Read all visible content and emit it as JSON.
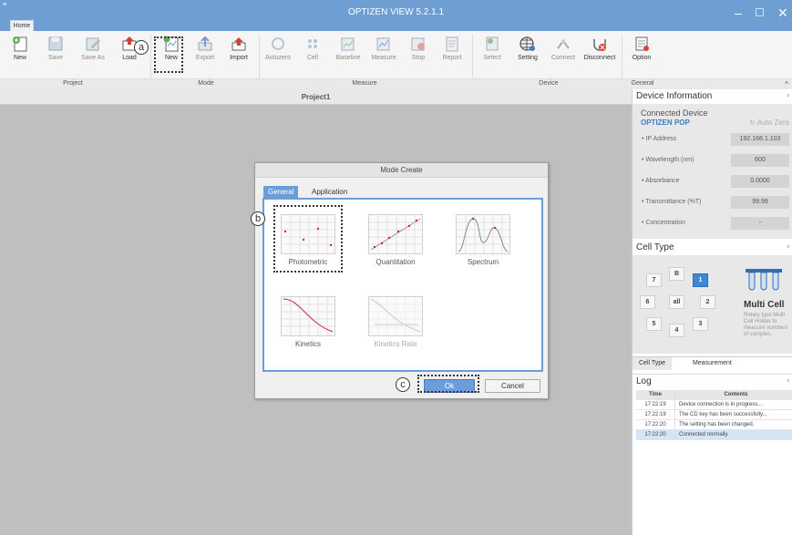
{
  "window": {
    "title": "OPTIZEN VIEW 5.2.1.1",
    "tab_home": "Home",
    "quick_access": "≡"
  },
  "ribbon": {
    "project": {
      "label": "Project",
      "buttons": [
        "New",
        "Save",
        "Save As",
        "Load"
      ]
    },
    "mode": {
      "label": "Mode",
      "buttons": [
        "New",
        "Export",
        "Import"
      ]
    },
    "measure": {
      "label": "Measure",
      "buttons": [
        "Autozero",
        "Cell",
        "Baseline",
        "Measure",
        "Stop",
        "Report"
      ]
    },
    "device": {
      "label": "Device",
      "buttons": [
        "Select",
        "Setting",
        "Connect",
        "Disconnect"
      ]
    },
    "general": {
      "label": "General",
      "buttons": [
        "Option"
      ]
    }
  },
  "document": {
    "tab": "Project1"
  },
  "device_info": {
    "title": "Device Information",
    "connected_label": "Connected Device",
    "device_name": "OPTIZEN POP",
    "auto_zero": "Auto Zero",
    "rows": [
      {
        "label": "• IP Address",
        "value": "192.168.1.103"
      },
      {
        "label": "• Wavelength (nm)",
        "value": "600"
      },
      {
        "label": "• Absorbance",
        "value": "0.0000"
      },
      {
        "label": "• Transmittance (%T)",
        "value": "99.99"
      },
      {
        "label": "• Concentration",
        "value": "-"
      }
    ]
  },
  "cell_type": {
    "title": "Cell Type",
    "cells": [
      "7",
      "B",
      "1",
      "6",
      "all",
      "2",
      "5",
      "4",
      "3"
    ],
    "selected": "1",
    "holder_name": "Multi Cell",
    "holder_desc": "Rotary type Multi Cell Holder to measure numbers of samples.",
    "tabs": [
      "Cell Type",
      "Measurement"
    ]
  },
  "log": {
    "title": "Log",
    "headers": [
      "Time",
      "Contents"
    ],
    "rows": [
      {
        "time": "17:22:19",
        "content": "Device connection is in progress..."
      },
      {
        "time": "17:22:19",
        "content": "The CD key has been successfully..."
      },
      {
        "time": "17:22:20",
        "content": "The setting has been changed."
      },
      {
        "time": "17:22:20",
        "content": "Connected normally."
      }
    ]
  },
  "dialog": {
    "title": "Mode Create",
    "tabs": [
      "General",
      "Application"
    ],
    "modes": [
      "Photometric",
      "Quantitation",
      "Spectrum",
      "Kinetics",
      "Kinetics Rate"
    ],
    "ok": "Ok",
    "cancel": "Cancel"
  },
  "callouts": [
    "a",
    "b",
    "c"
  ],
  "colors": {
    "accent": "#6f9ed3",
    "selected_cell": "#3c88d6",
    "workspace": "#bfbfbf"
  }
}
